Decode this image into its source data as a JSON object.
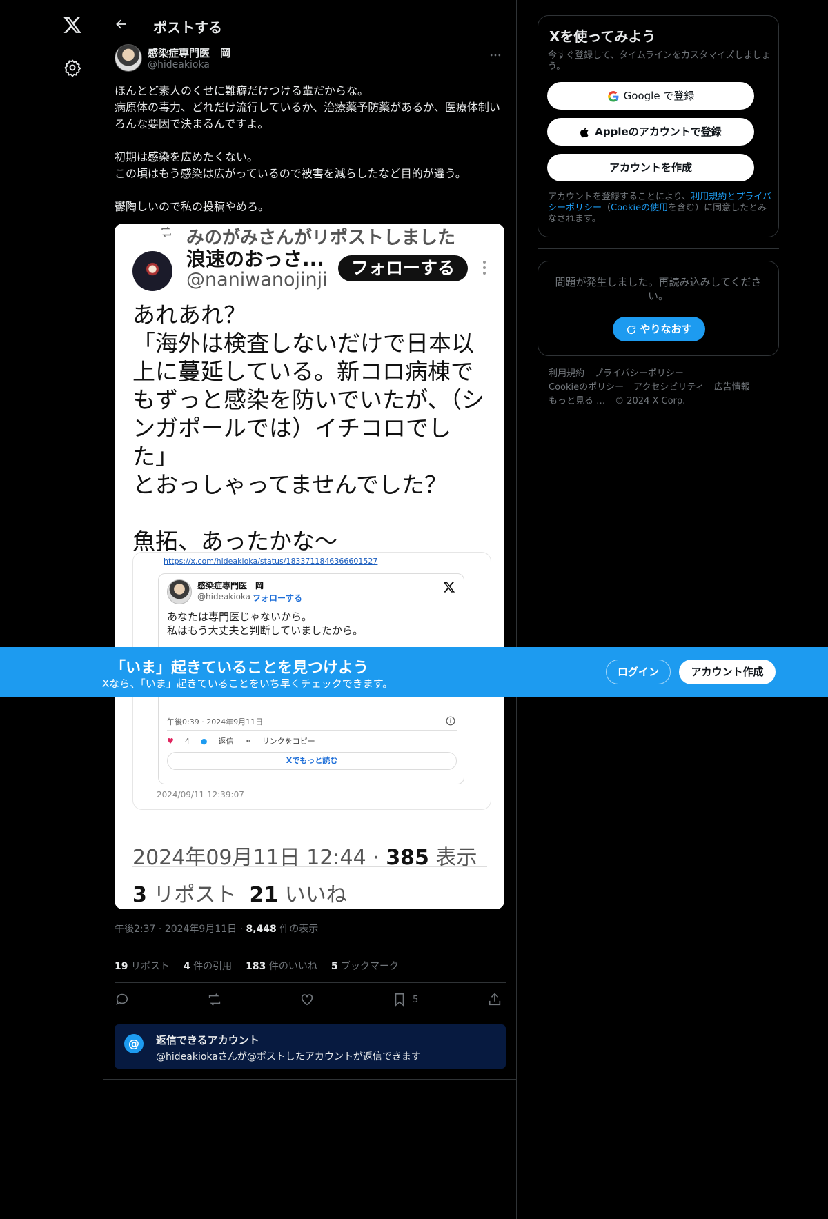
{
  "header": {
    "title": "ポストする"
  },
  "author": {
    "name": "感染症専門医　岡",
    "handle": "@hideakioka"
  },
  "tweet": {
    "text": "ほんとど素人のくせに難癖だけつける輩だからな。\n病原体の毒力、どれだけ流行しているか、治療薬予防薬があるか、医療体制いろんな要因で決まるんですよ。\n\n初期は感染を広めたくない。\nこの頃はもう感染は広がっているので被害を減らしたなど目的が違う。\n\n鬱陶しいので私の投稿やめろ。"
  },
  "media": {
    "repost_label": "みのがみさんがリポストしました",
    "name": "浪速のおっさ...",
    "handle": "@naniwanojinji",
    "follow": "フォローする",
    "body": "あれあれ？\n「海外は検査しないだけで日本以上に蔓延している。新コロ病棟でもずっと感染を防いでいたが、（シンガポールでは）イチコロでした」\nとおっしゃってませんでした？\n\n魚拓、あったかな〜",
    "card_url": "https://x.com/hideakioka/status/1833711846366601527",
    "inner_name": "感染症専門医　岡",
    "inner_handle": "@hideakioka ·",
    "inner_follow": "フォローする",
    "inner_text": "あなたは専門医じゃないから。\n私はもう大丈夫と判断していましたから。",
    "inner_date": "午後0:39 · 2024年9月11日",
    "inner_likes": "4",
    "inner_reply": "返信",
    "inner_copy": "リンクをコピー",
    "inner_more": "Xでもっと読む",
    "stamp": "2024/09/11 12:39:07",
    "meta_date": "2024年09月11日 12:44 ·",
    "meta_views": "385",
    "meta_views_label": "表示",
    "reposts": "3",
    "reposts_label": "リポスト",
    "likes": "21",
    "likes_label": "いいね"
  },
  "meta": {
    "time": "午後2:37 · 2024年9月11日 · ",
    "views": "8,448",
    "views_label": " 件の表示"
  },
  "stats": [
    {
      "num": "19",
      "label": " リポスト"
    },
    {
      "num": "4",
      "label": " 件の引用"
    },
    {
      "num": "183",
      "label": " 件のいいね"
    },
    {
      "num": "5",
      "label": " ブックマーク"
    }
  ],
  "actions": {
    "bookmark_count": "5"
  },
  "reply_box": {
    "title": "返信できるアカウント",
    "desc": "@hideakiokaさんが@ポストしたアカウントが返信できます"
  },
  "signup": {
    "title": "Xを使ってみよう",
    "sub": "今すぐ登録して、タイムラインをカスタマイズしましょう。",
    "google": "Google で登録",
    "apple": "Appleのアカウントで登録",
    "create": "アカウントを作成",
    "legal_1": "アカウントを登録することにより、",
    "legal_terms": "利用規約",
    "legal_and": "と",
    "legal_privacy": "プライバシーポリシー",
    "legal_2": "（",
    "legal_cookie": "Cookieの使用",
    "legal_3": "を含む）に同意したとみなされます。"
  },
  "error": {
    "text": "問題が発生しました。再読み込みしてください。",
    "retry": "やりなおす"
  },
  "footer": {
    "links": [
      "利用規約",
      "プライバシーポリシー",
      "Cookieのポリシー",
      "アクセシビリティ",
      "広告情報",
      "もっと見る …",
      "© 2024 X Corp."
    ]
  },
  "banner": {
    "title": "「いま」起きていることを見つけよう",
    "sub": "Xなら、「いま」起きていることをいち早くチェックできます。",
    "login": "ログイン",
    "signup": "アカウント作成"
  },
  "colors": {
    "accent": "#1d9bf0",
    "background": "#000000",
    "border": "#2f3336",
    "muted": "#71767b"
  }
}
